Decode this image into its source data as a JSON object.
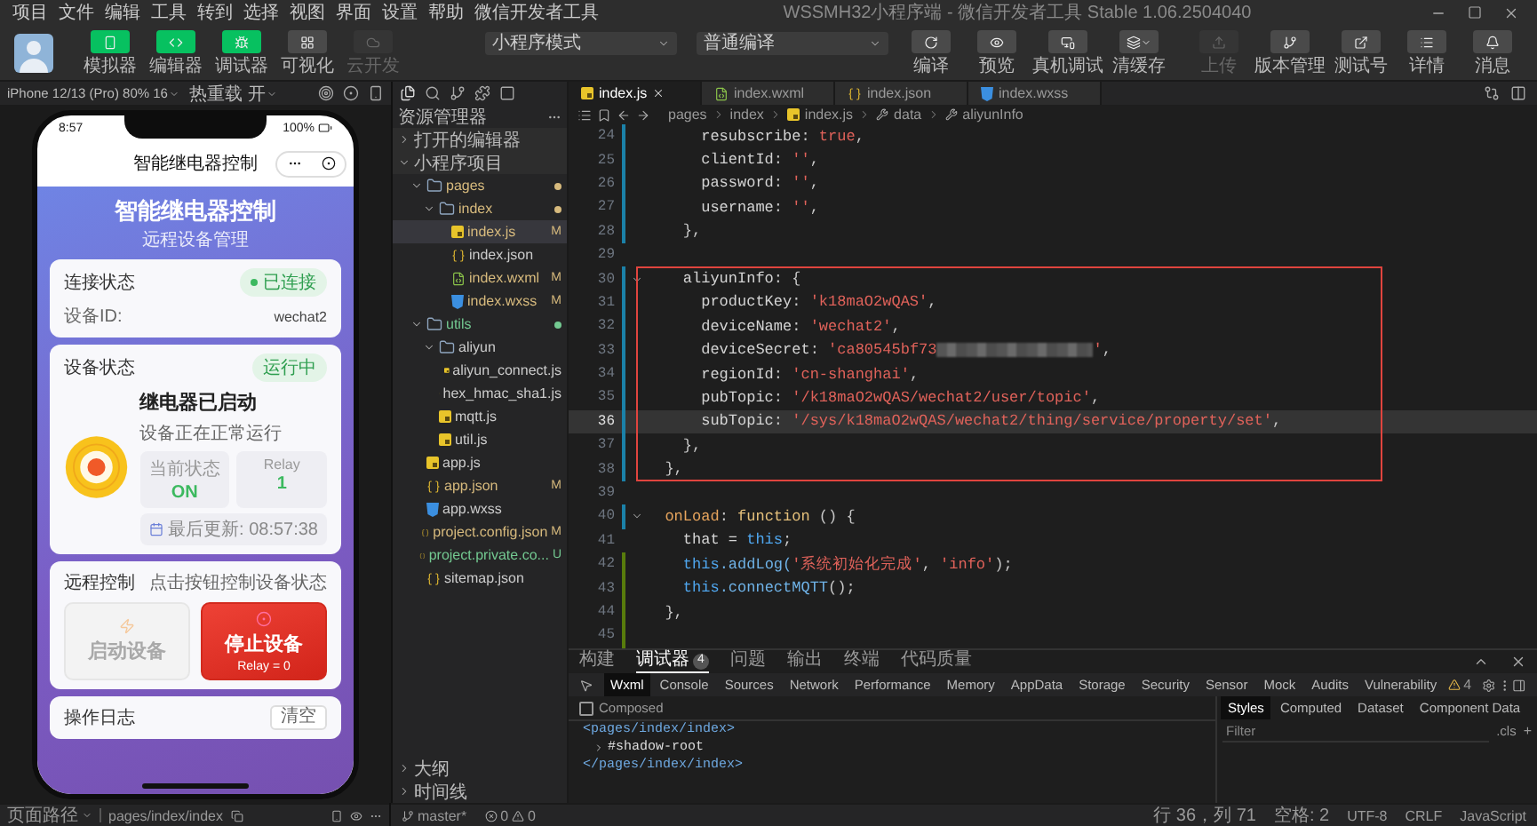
{
  "menu": [
    "项目",
    "文件",
    "编辑",
    "工具",
    "转到",
    "选择",
    "视图",
    "界面",
    "设置",
    "帮助",
    "微信开发者工具"
  ],
  "window": {
    "title": "WSSMH32小程序端 - 微信开发者工具 Stable 1.06.2504040"
  },
  "toolbar": {
    "left": [
      {
        "label": "模拟器",
        "active": true,
        "disabled": false
      },
      {
        "label": "编辑器",
        "active": true,
        "disabled": false
      },
      {
        "label": "调试器",
        "active": true,
        "disabled": false
      },
      {
        "label": "可视化",
        "active": false,
        "disabled": false
      },
      {
        "label": "云开发",
        "active": false,
        "disabled": true
      }
    ],
    "mode": "小程序模式",
    "compile": "普通编译",
    "actions": [
      {
        "label": "编译",
        "dropdown": false
      },
      {
        "label": "预览",
        "dropdown": false
      },
      {
        "label": "真机调试",
        "dropdown": false
      },
      {
        "label": "清缓存",
        "dropdown": true
      }
    ],
    "right": [
      {
        "label": "上传",
        "disabled": true
      },
      {
        "label": "版本管理",
        "disabled": false
      },
      {
        "label": "测试号",
        "disabled": false
      },
      {
        "label": "详情",
        "disabled": false
      },
      {
        "label": "消息",
        "disabled": false
      }
    ]
  },
  "simulator": {
    "device": "iPhone 12/13 (Pro) 80% 16",
    "hot_reload": "热重载 开",
    "page_path_label": "页面路径",
    "page_path": "pages/index/index",
    "phone": {
      "time": "8:57",
      "battery": "100%",
      "nav_title": "智能继电器控制",
      "heading": "智能继电器控制",
      "subheading": "远程设备管理",
      "connection": {
        "title": "连接状态",
        "badge": "已连接",
        "online": true,
        "id_label": "设备ID:",
        "id_value": "wechat2"
      },
      "device": {
        "title": "设备状态",
        "badge": "运行中",
        "on": true,
        "headline": "继电器已启动",
        "detail": "设备正在正常运行",
        "stats": [
          {
            "label": "当前状态",
            "value": "ON"
          },
          {
            "label": "Relay",
            "value": "1"
          }
        ],
        "updated": "最后更新: 08:57:38"
      },
      "control": {
        "title": "远程控制",
        "hint": "点击按钮控制设备状态",
        "buttons": [
          {
            "label": "启动设备",
            "disabled": true
          },
          {
            "label": "停止设备",
            "sub": "Relay = 0",
            "disabled": false
          }
        ]
      },
      "log": {
        "title": "操作日志",
        "button": "清空"
      }
    }
  },
  "explorer": {
    "title": "资源管理器",
    "sections": [
      {
        "title": "打开的编辑器",
        "expanded": false
      },
      {
        "title": "小程序项目",
        "expanded": true
      }
    ],
    "tree": [
      {
        "name": "pages",
        "kind": "folder",
        "expanded": true,
        "selected": false,
        "changed": true,
        "children": [
          {
            "name": "index",
            "kind": "folder",
            "expanded": true,
            "selected": false,
            "changed": true,
            "children": [
              {
                "name": "index.js",
                "kind": "js",
                "selected": true,
                "changed": true,
                "badge": "M"
              },
              {
                "name": "index.json",
                "kind": "json",
                "selected": false
              },
              {
                "name": "index.wxml",
                "kind": "wxml",
                "selected": false,
                "changed": true,
                "badge": "M"
              },
              {
                "name": "index.wxss",
                "kind": "wxss",
                "selected": false,
                "changed": true,
                "badge": "M"
              }
            ]
          }
        ]
      },
      {
        "name": "utils",
        "kind": "folder",
        "expanded": true,
        "selected": false,
        "untracked": true,
        "children": [
          {
            "name": "aliyun",
            "kind": "folder",
            "expanded": true,
            "selected": false,
            "children": [
              {
                "name": "aliyun_connect.js",
                "kind": "js",
                "selected": false
              },
              {
                "name": "hex_hmac_sha1.js",
                "kind": "js",
                "selected": false
              }
            ]
          },
          {
            "name": "mqtt.js",
            "kind": "js",
            "selected": false
          },
          {
            "name": "util.js",
            "kind": "js",
            "selected": false
          }
        ]
      },
      {
        "name": "app.js",
        "kind": "js",
        "selected": false
      },
      {
        "name": "app.json",
        "kind": "json",
        "selected": false,
        "changed": true,
        "badge": "M"
      },
      {
        "name": "app.wxss",
        "kind": "wxss",
        "selected": false
      },
      {
        "name": "project.config.json",
        "kind": "json",
        "selected": false,
        "changed": true,
        "badge": "M"
      },
      {
        "name": "project.private.co...",
        "kind": "json",
        "selected": false,
        "untracked": true,
        "badge": "U"
      },
      {
        "name": "sitemap.json",
        "kind": "json",
        "selected": false
      }
    ],
    "bottom": [
      {
        "title": "大纲",
        "expanded": false
      },
      {
        "title": "时间线",
        "expanded": false
      }
    ]
  },
  "editor": {
    "tabs": [
      {
        "name": "index.js",
        "kind": "js",
        "selected": true
      },
      {
        "name": "index.wxml",
        "kind": "wxml",
        "selected": false
      },
      {
        "name": "index.json",
        "kind": "json",
        "selected": false
      },
      {
        "name": "index.wxss",
        "kind": "wxss",
        "selected": false
      }
    ],
    "breadcrumb": [
      {
        "text": "pages",
        "kind": "folder"
      },
      {
        "text": "index",
        "kind": "folder"
      },
      {
        "text": "index.js",
        "kind": "js"
      },
      {
        "text": "data",
        "kind": "prop"
      },
      {
        "text": "aliyunInfo",
        "kind": "prop"
      }
    ],
    "lines": [
      {
        "n": "24",
        "changed": true,
        "tokens": [
          {
            "text": "      resubscribe",
            "kind": "prop"
          },
          {
            "text": ": ",
            "kind": "punct"
          },
          {
            "text": "true",
            "kind": "kw"
          },
          {
            "text": ",",
            "kind": "punct"
          }
        ]
      },
      {
        "n": "25",
        "changed": true,
        "tokens": [
          {
            "text": "      clientId",
            "kind": "prop"
          },
          {
            "text": ": ",
            "kind": "punct"
          },
          {
            "text": "''",
            "kind": "str"
          },
          {
            "text": ",",
            "kind": "punct"
          }
        ]
      },
      {
        "n": "26",
        "changed": true,
        "tokens": [
          {
            "text": "      password",
            "kind": "prop"
          },
          {
            "text": ": ",
            "kind": "punct"
          },
          {
            "text": "''",
            "kind": "str"
          },
          {
            "text": ",",
            "kind": "punct"
          }
        ]
      },
      {
        "n": "27",
        "changed": true,
        "tokens": [
          {
            "text": "      username",
            "kind": "prop"
          },
          {
            "text": ": ",
            "kind": "punct"
          },
          {
            "text": "''",
            "kind": "str"
          },
          {
            "text": ",",
            "kind": "punct"
          }
        ]
      },
      {
        "n": "28",
        "changed": true,
        "tokens": [
          {
            "text": "    },",
            "kind": "punct"
          }
        ]
      },
      {
        "n": "29"
      },
      {
        "n": "30",
        "changed": true,
        "fold": true,
        "boxed": true,
        "tokens": [
          {
            "text": "    aliyunInfo",
            "kind": "prop"
          },
          {
            "text": ": {",
            "kind": "punct"
          }
        ]
      },
      {
        "n": "31",
        "changed": true,
        "boxed": true,
        "tokens": [
          {
            "text": "      productKey",
            "kind": "prop"
          },
          {
            "text": ": ",
            "kind": "punct"
          },
          {
            "text": "'k18maO2wQAS'",
            "kind": "str"
          },
          {
            "text": ",",
            "kind": "punct"
          }
        ]
      },
      {
        "n": "32",
        "changed": true,
        "boxed": true,
        "tokens": [
          {
            "text": "      deviceName",
            "kind": "prop"
          },
          {
            "text": ": ",
            "kind": "punct"
          },
          {
            "text": "'wechat2'",
            "kind": "str"
          },
          {
            "text": ",",
            "kind": "punct"
          }
        ]
      },
      {
        "n": "33",
        "changed": true,
        "boxed": true,
        "tokens": [
          {
            "text": "      deviceSecret",
            "kind": "prop"
          },
          {
            "text": ": ",
            "kind": "punct"
          },
          {
            "text": "'ca80545bf73",
            "kind": "str"
          },
          {
            "kind": "redacted"
          },
          {
            "text": "'",
            "kind": "str"
          },
          {
            "text": ",",
            "kind": "punct"
          }
        ]
      },
      {
        "n": "34",
        "changed": true,
        "boxed": true,
        "tokens": [
          {
            "text": "      regionId",
            "kind": "prop"
          },
          {
            "text": ": ",
            "kind": "punct"
          },
          {
            "text": "'cn-shanghai'",
            "kind": "str"
          },
          {
            "text": ",",
            "kind": "punct"
          }
        ]
      },
      {
        "n": "35",
        "changed": true,
        "boxed": true,
        "tokens": [
          {
            "text": "      pubTopic",
            "kind": "prop"
          },
          {
            "text": ": ",
            "kind": "punct"
          },
          {
            "text": "'/k18maO2wQAS/wechat2/user/topic'",
            "kind": "str"
          },
          {
            "text": ",",
            "kind": "punct"
          }
        ]
      },
      {
        "n": "36",
        "changed": true,
        "boxed": true,
        "current": true,
        "tokens": [
          {
            "text": "      subTopic",
            "kind": "prop"
          },
          {
            "text": ": ",
            "kind": "punct"
          },
          {
            "text": "'/sys/k18maO2wQAS/wechat2/thing/service/property/set'",
            "kind": "str"
          },
          {
            "text": ",",
            "kind": "punct"
          }
        ]
      },
      {
        "n": "37",
        "changed": true,
        "boxed": true,
        "tokens": [
          {
            "text": "    },",
            "kind": "punct"
          }
        ]
      },
      {
        "n": "38",
        "changed": true,
        "boxed": true,
        "tokens": [
          {
            "text": "  },",
            "kind": "punct"
          }
        ]
      },
      {
        "n": "39"
      },
      {
        "n": "40",
        "changed": true,
        "fold": true,
        "tokens": [
          {
            "text": "  onLoad",
            "kind": "fn"
          },
          {
            "text": ": ",
            "kind": "punct"
          },
          {
            "text": "function",
            "kind": "kw2"
          },
          {
            "text": " () {",
            "kind": "punct"
          }
        ]
      },
      {
        "n": "41",
        "tokens": [
          {
            "text": "    that = ",
            "kind": "prop"
          },
          {
            "text": "this",
            "kind": "this"
          },
          {
            "text": ";",
            "kind": "punct"
          }
        ]
      },
      {
        "n": "42",
        "added": true,
        "tokens": [
          {
            "text": "    this",
            "kind": "this"
          },
          {
            "text": ".addLog(",
            "kind": "call"
          },
          {
            "text": "'系统初始化完成'",
            "kind": "str"
          },
          {
            "text": ", ",
            "kind": "punct"
          },
          {
            "text": "'info'",
            "kind": "str"
          },
          {
            "text": ");",
            "kind": "punct"
          }
        ]
      },
      {
        "n": "43",
        "added": true,
        "tokens": [
          {
            "text": "    this",
            "kind": "this"
          },
          {
            "text": ".connectMQTT",
            "kind": "call"
          },
          {
            "text": "();",
            "kind": "punct"
          }
        ]
      },
      {
        "n": "44",
        "added": true,
        "tokens": [
          {
            "text": "  },",
            "kind": "punct"
          }
        ]
      },
      {
        "n": "45",
        "added": true
      }
    ]
  },
  "devtools": {
    "panels": [
      {
        "label": "构建",
        "selected": false
      },
      {
        "label": "调试器",
        "selected": true,
        "count": "4"
      },
      {
        "label": "问题",
        "selected": false
      },
      {
        "label": "输出",
        "selected": false
      },
      {
        "label": "终端",
        "selected": false
      },
      {
        "label": "代码质量",
        "selected": false
      }
    ],
    "tools": [
      {
        "label": "Wxml",
        "selected": true
      },
      {
        "label": "Console",
        "selected": false
      },
      {
        "label": "Sources",
        "selected": false
      },
      {
        "label": "Network",
        "selected": false
      },
      {
        "label": "Performance",
        "selected": false
      },
      {
        "label": "Memory",
        "selected": false
      },
      {
        "label": "AppData",
        "selected": false
      },
      {
        "label": "Storage",
        "selected": false
      },
      {
        "label": "Security",
        "selected": false
      },
      {
        "label": "Sensor",
        "selected": false
      },
      {
        "label": "Mock",
        "selected": false
      },
      {
        "label": "Audits",
        "selected": false
      },
      {
        "label": "Vulnerability",
        "selected": false
      }
    ],
    "warnings": "4",
    "composed": {
      "label": "Composed",
      "checked": false
    },
    "dom": [
      {
        "text": "<pages/index/index>",
        "kind": "tag"
      },
      {
        "text": "#shadow-root",
        "kind": "node",
        "expanded": false
      },
      {
        "text": "</pages/index/index>",
        "kind": "tag"
      }
    ],
    "style_tabs": [
      {
        "label": "Styles",
        "selected": true
      },
      {
        "label": "Computed",
        "selected": false
      },
      {
        "label": "Dataset",
        "selected": false
      },
      {
        "label": "Component Data",
        "selected": false
      }
    ],
    "filter": {
      "placeholder": "Filter"
    },
    "cls": ".cls",
    "add": "+"
  },
  "status": {
    "branch": "master*",
    "errors": "0",
    "warnings": "0",
    "cursor": "行 36，列 71",
    "indent": "空格: 2",
    "encoding": "UTF-8",
    "eol": "CRLF",
    "language": "JavaScript"
  }
}
